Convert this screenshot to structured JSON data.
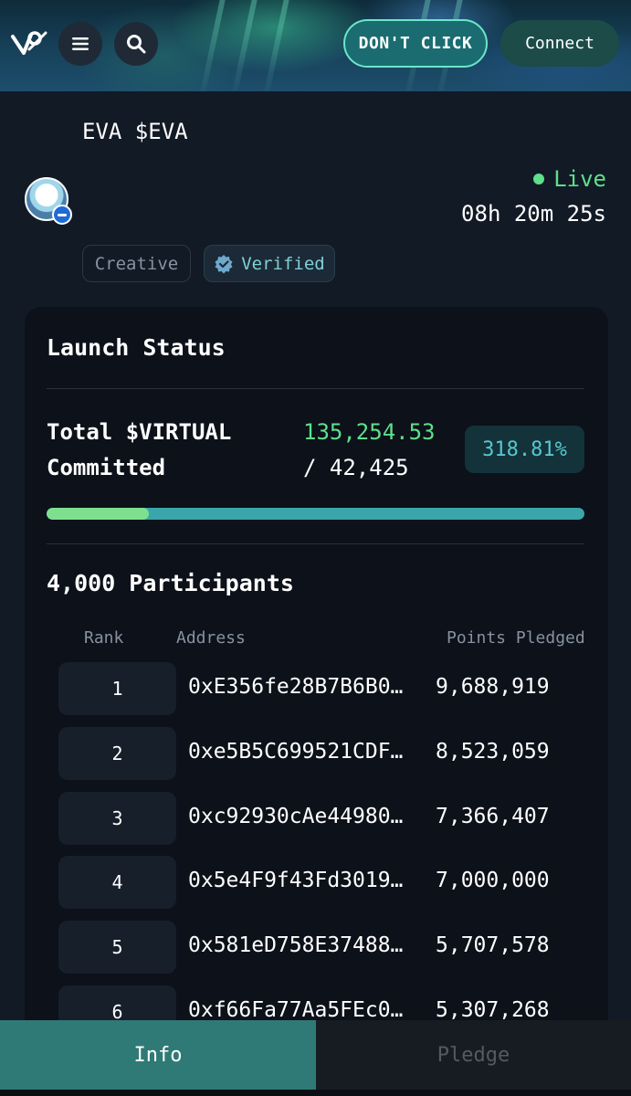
{
  "header": {
    "dont_click_label": "DON'T CLICK",
    "connect_label": "Connect",
    "colors": {
      "accent": "#6be6c9",
      "dont_click_bg": "#1a6c70",
      "connect_bg": "#1c4b48"
    }
  },
  "token": {
    "title": "EVA $EVA",
    "status": "Live",
    "countdown": "08h 20m 25s",
    "tags": [
      "Creative",
      "Verified"
    ]
  },
  "launch": {
    "title": "Launch Status",
    "total_label_line1": "Total $VIRTUAL",
    "total_label_line2": "Committed",
    "committed": "135,254.53",
    "goal": "/ 42,425",
    "percent": "318.81%",
    "progress_fraction": 0.19
  },
  "participants": {
    "title": "4,000 Participants",
    "columns": [
      "Rank",
      "Address",
      "Points Pledged"
    ],
    "rows": [
      {
        "rank": "1",
        "address": "0xE356fe28B7B6B0…",
        "points": "9,688,919"
      },
      {
        "rank": "2",
        "address": "0xe5B5C699521CDF…",
        "points": "8,523,059"
      },
      {
        "rank": "3",
        "address": "0xc92930cAe44980…",
        "points": "7,366,407"
      },
      {
        "rank": "4",
        "address": "0x5e4F9f43Fd3019…",
        "points": "7,000,000"
      },
      {
        "rank": "5",
        "address": "0x581eD758E37488…",
        "points": "5,707,578"
      },
      {
        "rank": "6",
        "address": "0xf66Fa77Aa5FEc0…",
        "points": "5,307,268"
      }
    ]
  },
  "tabs": {
    "info": "Info",
    "pledge": "Pledge"
  }
}
